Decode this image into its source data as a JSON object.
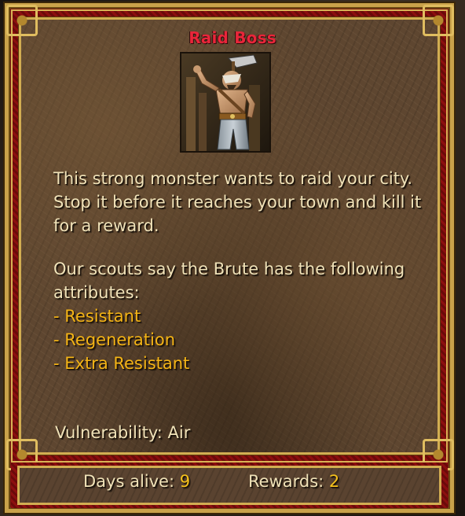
{
  "dialog": {
    "title": "Raid Boss",
    "portrait_icon": "brute-monster-portrait",
    "description": "This strong monster wants to raid your city. Stop it before it reaches your town and kill it for a reward.",
    "scouts_intro": "Our scouts say the Brute has the following attributes:",
    "attributes": [
      "- Resistant",
      "- Regeneration",
      "- Extra Resistant"
    ],
    "vulnerability": "Vulnerability: Air"
  },
  "footer": {
    "days_alive_label": "Days alive:",
    "days_alive_value": "9",
    "rewards_label": "Rewards:",
    "rewards_value": "2"
  },
  "colors": {
    "title": "#e8263a",
    "text": "#f0e2b8",
    "attribute": "#f4b416",
    "value": "#f6c21c",
    "frame_gold": "#d2ad52",
    "frame_red": "#8c0f0f"
  }
}
